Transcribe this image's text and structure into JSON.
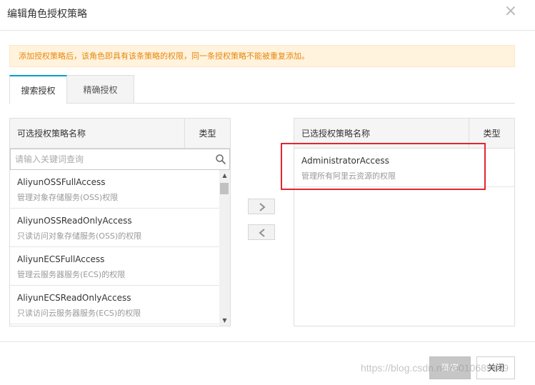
{
  "dialog": {
    "title": "编辑角色授权策略",
    "close_glyph": "×"
  },
  "notice": "添加授权策略后，该角色即具有该条策略的权限，同一条授权策略不能被重复添加。",
  "tabs": [
    {
      "label": "搜索授权",
      "active": true
    },
    {
      "label": "精确授权",
      "active": false
    }
  ],
  "available": {
    "col_name": "可选授权策略名称",
    "col_type": "类型",
    "search_placeholder": "请输入关键词查询",
    "items": [
      {
        "name": "AliyunOSSFullAccess",
        "desc": "管理对象存储服务(OSS)权限"
      },
      {
        "name": "AliyunOSSReadOnlyAccess",
        "desc": "只读访问对象存储服务(OSS)的权限"
      },
      {
        "name": "AliyunECSFullAccess",
        "desc": "管理云服务器服务(ECS)的权限"
      },
      {
        "name": "AliyunECSReadOnlyAccess",
        "desc": "只读访问云服务器服务(ECS)的权限"
      }
    ]
  },
  "selected": {
    "col_name": "已选授权策略名称",
    "col_type": "类型",
    "items": [
      {
        "name": "AdministratorAccess",
        "desc": "管理所有阿里云资源的权限"
      }
    ]
  },
  "footer": {
    "ok_label": "确定",
    "close_label": "关闭"
  },
  "watermark": "https://blog.csdn.net/u010689419",
  "colors": {
    "accent": "#00a2ca",
    "notice_bg": "#fff3dd",
    "notice_text": "#e6870f",
    "highlight": "#e3262f"
  }
}
